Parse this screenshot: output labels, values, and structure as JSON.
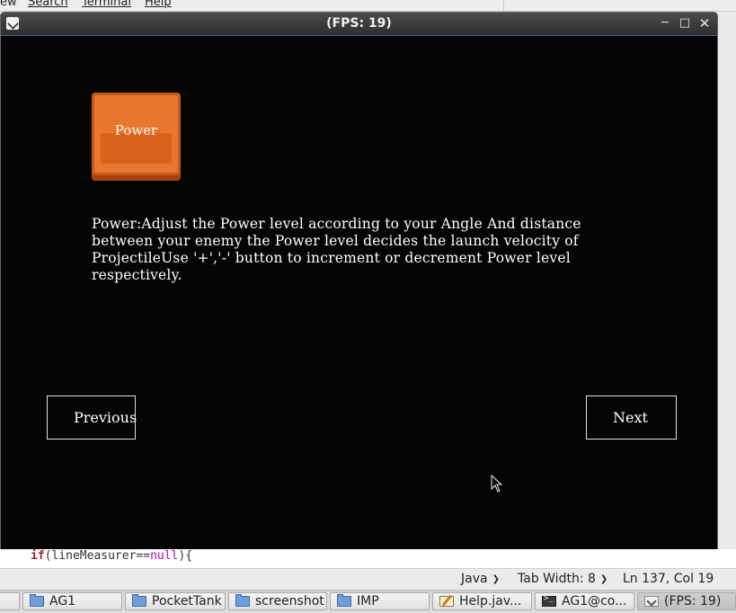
{
  "bg_editor": {
    "menu": [
      "ew",
      "Search",
      "Terminal",
      "Help"
    ],
    "code_line": {
      "keyword": "if",
      "before": "(lineMeasurer==",
      "literal": "null",
      "after": "){"
    },
    "status": {
      "language": "Java",
      "tab_width": "Tab Width: 8",
      "position": "Ln 137, Col 19"
    }
  },
  "window": {
    "title": "(FPS: 19)"
  },
  "content": {
    "key_label": "Power",
    "description_lines": [
      "Power:Adjust the Power level according to your Angle And distance",
      "between your enemy the Power level decides the launch velocity of",
      "ProjectileUse '+','-' button to increment or decrement Power level",
      "respectively."
    ],
    "prev_label": "Previous",
    "next_label": "Next"
  },
  "taskbar": [
    {
      "label": "AG1",
      "icon": "folder-icon"
    },
    {
      "label": "PocketTank",
      "icon": "folder-icon"
    },
    {
      "label": "screenshot",
      "icon": "folder-icon"
    },
    {
      "label": "IMP",
      "icon": "folder-icon"
    },
    {
      "label": "Help.jav...",
      "icon": "edit-icon"
    },
    {
      "label": "AG1@co...",
      "icon": "terminal-icon"
    },
    {
      "label": "(FPS: 19)",
      "icon": "java-icon"
    }
  ],
  "colors": {
    "key_orange": "#e8772e",
    "canvas_bg": "#050505",
    "titlebar": "#3a3a3a"
  }
}
